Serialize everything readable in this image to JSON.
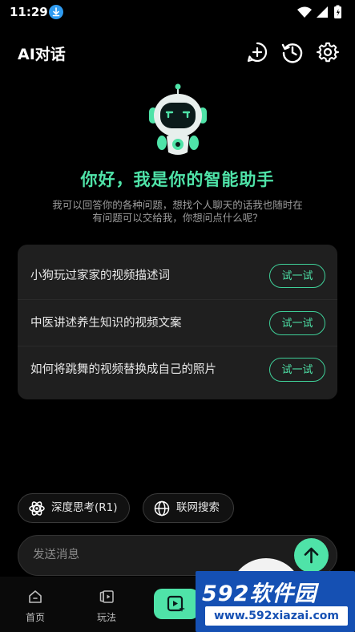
{
  "status_bar": {
    "time": "11:29"
  },
  "header": {
    "title": "AI对话"
  },
  "hero": {
    "greeting": "你好，我是你的智能助手",
    "intro_line1": "我可以回答你的各种问题，想找个人聊天的话我也随时在",
    "intro_line2": "有问题可以交给我，你想问点什么呢？"
  },
  "suggestions": [
    {
      "text": "小狗玩过家家的视频描述词",
      "button": "试一试"
    },
    {
      "text": "中医讲述养生知识的视频文案",
      "button": "试一试"
    },
    {
      "text": "如何将跳舞的视频替换成自己的照片",
      "button": "试一试"
    }
  ],
  "chips": [
    {
      "label": "深度思考(R1)",
      "icon": "atom-icon"
    },
    {
      "label": "联网搜索",
      "icon": "globe-icon"
    }
  ],
  "input": {
    "placeholder": "发送消息"
  },
  "nav": {
    "items": [
      {
        "label": "首页",
        "icon": "home-icon"
      },
      {
        "label": "玩法",
        "icon": "play-card-icon"
      }
    ]
  },
  "watermark": {
    "brand_num": "592",
    "brand_text": "软件园",
    "url": "www.592xiazai.com"
  },
  "colors": {
    "accent": "#4fe3a8",
    "background": "#000000",
    "card": "#1f1f1f",
    "watermark_blue": "#1550b3"
  }
}
